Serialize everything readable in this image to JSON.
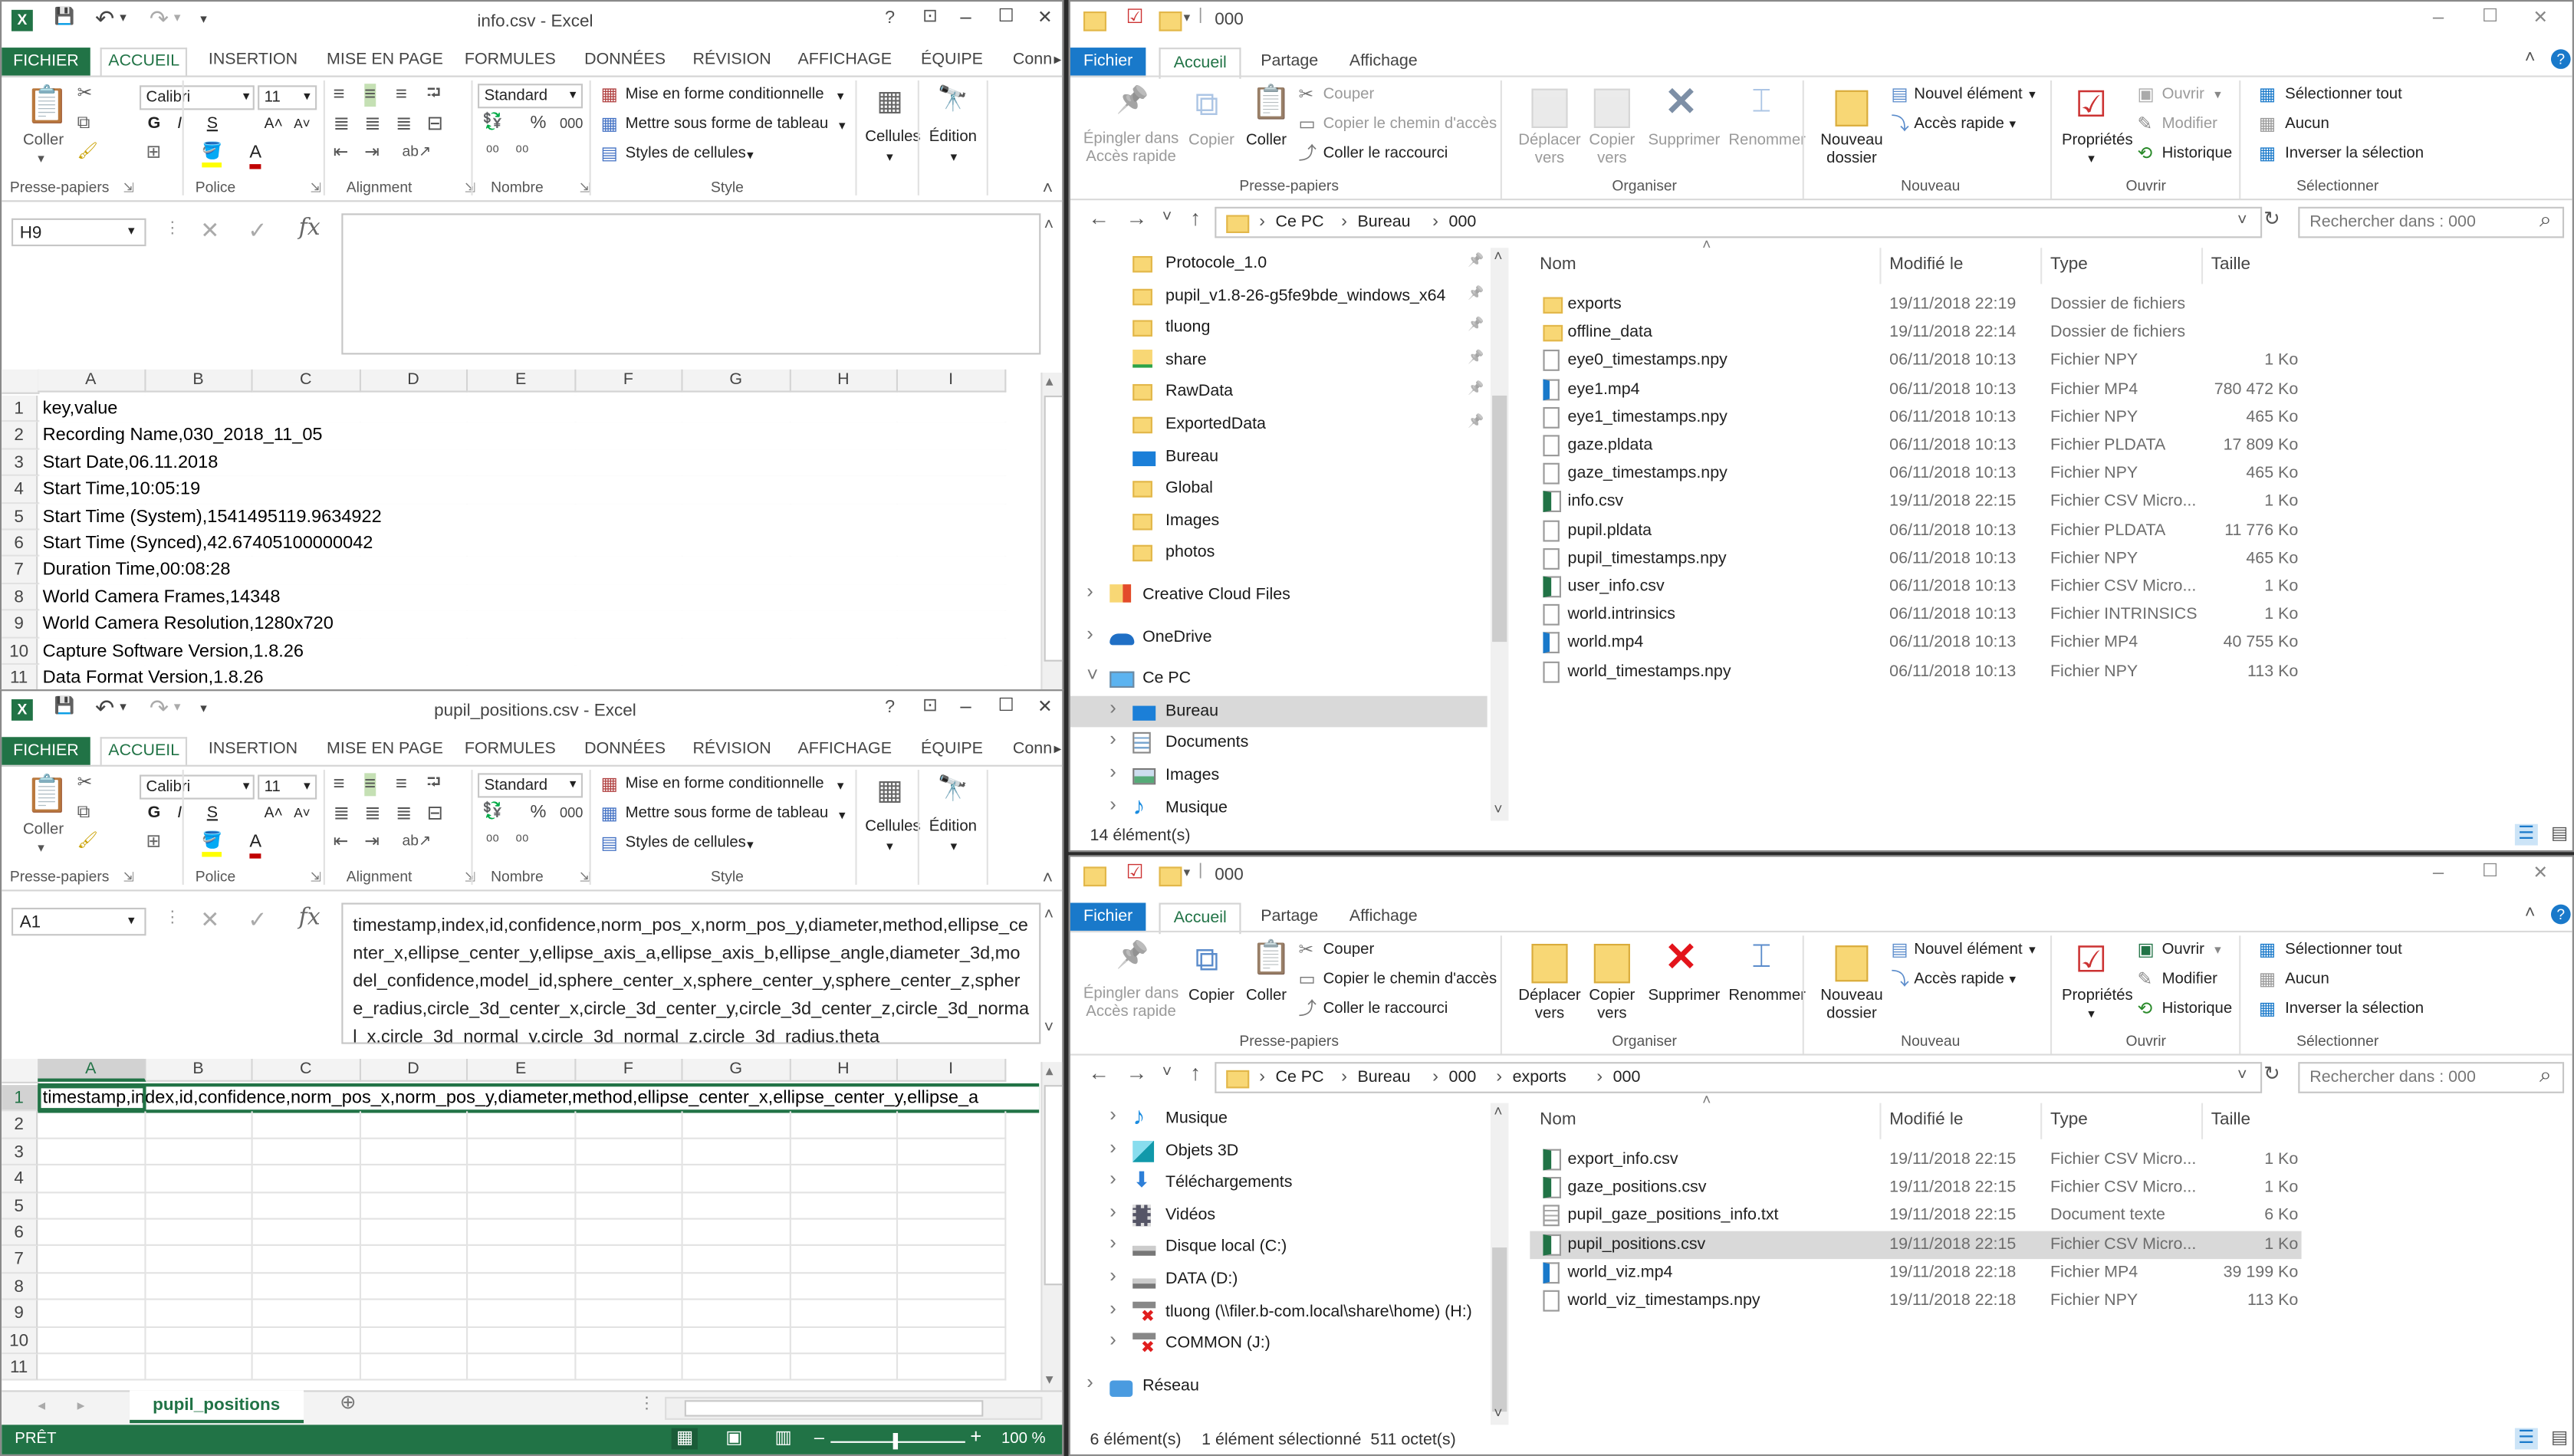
{
  "excel_ribbon": {
    "tabs": [
      "FICHIER",
      "ACCUEIL",
      "INSERTION",
      "MISE EN PAGE",
      "FORMULES",
      "DONNÉES",
      "RÉVISION",
      "AFFICHAGE",
      "ÉQUIPE",
      "Conn"
    ],
    "active_tab": "ACCUEIL",
    "paste_label": "Coller",
    "font_name": "Calibri",
    "font_size": "11",
    "bold": "G",
    "italic": "I",
    "underline": "S",
    "number_format": "Standard",
    "percent": "%",
    "thousands": "000",
    "conditional_format": "Mise en forme conditionnelle",
    "format_as_table": "Mettre sous forme de tableau",
    "cell_styles": "Styles de cellules",
    "cells": "Cellules",
    "editing": "Édition",
    "groups": [
      "Presse-papiers",
      "Police",
      "Alignment",
      "Nombre",
      "Style"
    ],
    "fx": "fx",
    "columns": [
      "A",
      "B",
      "C",
      "D",
      "E",
      "F",
      "G",
      "H",
      "I"
    ],
    "accent": "#217346"
  },
  "excel_windows": [
    {
      "title": "info.csv - Excel",
      "name_box": "H9",
      "formula": "",
      "row_numbers": [
        "1",
        "2",
        "3",
        "4",
        "5",
        "6",
        "7",
        "8",
        "9",
        "10",
        "11"
      ],
      "cells_col_a": [
        "key,value",
        "Recording Name,030_2018_11_05",
        "Start Date,06.11.2018",
        "Start Time,10:05:19",
        "Start Time (System),1541495119.9634922",
        "Start Time (Synced),42.67405100000042",
        "Duration Time,00:08:28",
        "World Camera Frames,14348",
        "World Camera Resolution,1280x720",
        "Capture Software Version,1.8.26",
        "Data Format Version,1.8.26"
      ]
    },
    {
      "title": "pupil_positions.csv - Excel",
      "name_box": "A1",
      "formula": "timestamp,index,id,confidence,norm_pos_x,norm_pos_y,diameter,method,ellipse_center_x,ellipse_center_y,ellipse_axis_a,ellipse_axis_b,ellipse_angle,diameter_3d,model_confidence,model_id,sphere_center_x,sphere_center_y,sphere_center_z,sphere_radius,circle_3d_center_x,circle_3d_center_y,circle_3d_center_z,circle_3d_normal_x,circle_3d_normal_y,circle_3d_normal_z,circle_3d_radius,theta",
      "row_numbers": [
        "1",
        "2",
        "3",
        "4",
        "5",
        "6",
        "7",
        "8",
        "9",
        "10",
        "11"
      ],
      "cells_col_a": [
        "timestamp,index,id,confidence,norm_pos_x,norm_pos_y,diameter,method,ellipse_center_x,ellipse_center_y,ellipse_a",
        "",
        "",
        "",
        "",
        "",
        "",
        "",
        "",
        "",
        ""
      ],
      "sheet_tab": "pupil_positions",
      "status": "PRÊT",
      "zoom": "100 %"
    }
  ],
  "explorer_ribbon": {
    "tabs": [
      "Fichier",
      "Accueil",
      "Partage",
      "Affichage"
    ],
    "active_tab": "Accueil",
    "pin": "Épingler dans Accès rapide",
    "copy": "Copier",
    "paste": "Coller",
    "cut": "Couper",
    "copy_path": "Copier le chemin d'accès",
    "paste_shortcut": "Coller le raccourci",
    "move_to": "Déplacer vers",
    "copy_to": "Copier vers",
    "delete": "Supprimer",
    "rename": "Renommer",
    "new_folder": "Nouveau dossier",
    "new_item": "Nouvel élément",
    "easy_access": "Accès rapide",
    "properties": "Propriétés",
    "open": "Ouvrir",
    "edit": "Modifier",
    "history": "Historique",
    "select_all": "Sélectionner tout",
    "select_none": "Aucun",
    "invert_selection": "Inverser la sélection",
    "groups": [
      "Presse-papiers",
      "Organiser",
      "Nouveau",
      "Ouvrir",
      "Sélectionner"
    ],
    "columns": [
      "Nom",
      "Modifié le",
      "Type",
      "Taille"
    ],
    "accent": "#1979ca"
  },
  "explorer_windows": [
    {
      "title": "000",
      "breadcrumb": [
        "Ce PC",
        "Bureau",
        "000"
      ],
      "search_placeholder": "Rechercher dans : 000",
      "disabled": [
        "pin",
        "copy",
        "cut",
        "copy_path",
        "move_to",
        "copy_to",
        "delete",
        "rename",
        "open",
        "edit"
      ],
      "nav": [
        {
          "label": "Protocole_1.0",
          "icon": "folder",
          "level": 2,
          "pinned": true
        },
        {
          "label": "pupil_v1.8-26-g5fe9bde_windows_x64",
          "icon": "folder",
          "level": 2,
          "pinned": true
        },
        {
          "label": "tluong",
          "icon": "folder",
          "level": 2,
          "pinned": true
        },
        {
          "label": "share",
          "icon": "network-folder",
          "level": 2,
          "pinned": true
        },
        {
          "label": "RawData",
          "icon": "folder",
          "level": 2,
          "pinned": true
        },
        {
          "label": "ExportedData",
          "icon": "folder",
          "level": 2,
          "pinned": true
        },
        {
          "label": "Bureau",
          "icon": "desktop",
          "level": 2
        },
        {
          "label": "Global",
          "icon": "folder",
          "level": 2
        },
        {
          "label": "Images",
          "icon": "folder",
          "level": 2
        },
        {
          "label": "photos",
          "icon": "folder",
          "level": 2
        },
        {
          "label": "Creative Cloud Files",
          "icon": "creative-cloud",
          "level": 1,
          "expander": ">",
          "gap": true
        },
        {
          "label": "OneDrive",
          "icon": "onedrive",
          "level": 1,
          "expander": ">",
          "gap": true
        },
        {
          "label": "Ce PC",
          "icon": "computer",
          "level": 1,
          "expander": "v",
          "gap": true
        },
        {
          "label": "Bureau",
          "icon": "desktop",
          "level": 2,
          "expander": ">",
          "selected": true
        },
        {
          "label": "Documents",
          "icon": "documents",
          "level": 2,
          "expander": ">"
        },
        {
          "label": "Images",
          "icon": "pictures",
          "level": 2,
          "expander": ">"
        },
        {
          "label": "Musique",
          "icon": "music",
          "level": 2,
          "expander": ">"
        }
      ],
      "files": [
        {
          "name": "exports",
          "modified": "19/11/2018 22:19",
          "type": "Dossier de fichiers",
          "size": "",
          "icon": "folder"
        },
        {
          "name": "offline_data",
          "modified": "19/11/2018 22:14",
          "type": "Dossier de fichiers",
          "size": "",
          "icon": "folder"
        },
        {
          "name": "eye0_timestamps.npy",
          "modified": "06/11/2018 10:13",
          "type": "Fichier NPY",
          "size": "1 Ko",
          "icon": "file"
        },
        {
          "name": "eye1.mp4",
          "modified": "06/11/2018 10:13",
          "type": "Fichier MP4",
          "size": "780 472 Ko",
          "icon": "video"
        },
        {
          "name": "eye1_timestamps.npy",
          "modified": "06/11/2018 10:13",
          "type": "Fichier NPY",
          "size": "465 Ko",
          "icon": "file"
        },
        {
          "name": "gaze.pldata",
          "modified": "06/11/2018 10:13",
          "type": "Fichier PLDATA",
          "size": "17 809 Ko",
          "icon": "file"
        },
        {
          "name": "gaze_timestamps.npy",
          "modified": "06/11/2018 10:13",
          "type": "Fichier NPY",
          "size": "465 Ko",
          "icon": "file"
        },
        {
          "name": "info.csv",
          "modified": "19/11/2018 22:15",
          "type": "Fichier CSV Micro...",
          "size": "1 Ko",
          "icon": "csv"
        },
        {
          "name": "pupil.pldata",
          "modified": "06/11/2018 10:13",
          "type": "Fichier PLDATA",
          "size": "11 776 Ko",
          "icon": "file"
        },
        {
          "name": "pupil_timestamps.npy",
          "modified": "06/11/2018 10:13",
          "type": "Fichier NPY",
          "size": "465 Ko",
          "icon": "file"
        },
        {
          "name": "user_info.csv",
          "modified": "06/11/2018 10:13",
          "type": "Fichier CSV Micro...",
          "size": "1 Ko",
          "icon": "csv"
        },
        {
          "name": "world.intrinsics",
          "modified": "06/11/2018 10:13",
          "type": "Fichier INTRINSICS",
          "size": "1 Ko",
          "icon": "file"
        },
        {
          "name": "world.mp4",
          "modified": "06/11/2018 10:13",
          "type": "Fichier MP4",
          "size": "40 755 Ko",
          "icon": "video"
        },
        {
          "name": "world_timestamps.npy",
          "modified": "06/11/2018 10:13",
          "type": "Fichier NPY",
          "size": "113 Ko",
          "icon": "file"
        }
      ],
      "status": "14 élément(s)",
      "selection_status": ""
    },
    {
      "title": "000",
      "breadcrumb": [
        "Ce PC",
        "Bureau",
        "000",
        "exports",
        "000"
      ],
      "search_placeholder": "Rechercher dans : 000",
      "disabled": [
        "pin"
      ],
      "nav": [
        {
          "label": "Musique",
          "icon": "music",
          "level": 2,
          "expander": ">"
        },
        {
          "label": "Objets 3D",
          "icon": "objects-3d",
          "level": 2,
          "expander": ">"
        },
        {
          "label": "Téléchargements",
          "icon": "downloads",
          "level": 2,
          "expander": ">"
        },
        {
          "label": "Vidéos",
          "icon": "videos",
          "level": 2,
          "expander": ">"
        },
        {
          "label": "Disque local (C:)",
          "icon": "drive",
          "level": 2,
          "expander": ">"
        },
        {
          "label": "DATA (D:)",
          "icon": "drive",
          "level": 2,
          "expander": ">"
        },
        {
          "label": "tluong (\\\\filer.b-com.local\\share\\home) (H:)",
          "icon": "network-drive-disconnected",
          "level": 2,
          "expander": ">"
        },
        {
          "label": "COMMON (J:)",
          "icon": "network-drive-disconnected",
          "level": 2,
          "expander": ">"
        },
        {
          "label": "Réseau",
          "icon": "network",
          "level": 1,
          "expander": ">",
          "gap": true
        }
      ],
      "files": [
        {
          "name": "export_info.csv",
          "modified": "19/11/2018 22:15",
          "type": "Fichier CSV Micro...",
          "size": "1 Ko",
          "icon": "csv"
        },
        {
          "name": "gaze_positions.csv",
          "modified": "19/11/2018 22:15",
          "type": "Fichier CSV Micro...",
          "size": "1 Ko",
          "icon": "csv"
        },
        {
          "name": "pupil_gaze_positions_info.txt",
          "modified": "19/11/2018 22:15",
          "type": "Document texte",
          "size": "6 Ko",
          "icon": "text"
        },
        {
          "name": "pupil_positions.csv",
          "modified": "19/11/2018 22:15",
          "type": "Fichier CSV Micro...",
          "size": "1 Ko",
          "icon": "csv",
          "selected": true
        },
        {
          "name": "world_viz.mp4",
          "modified": "19/11/2018 22:18",
          "type": "Fichier MP4",
          "size": "39 199 Ko",
          "icon": "video"
        },
        {
          "name": "world_viz_timestamps.npy",
          "modified": "19/11/2018 22:18",
          "type": "Fichier NPY",
          "size": "113 Ko",
          "icon": "file"
        }
      ],
      "status": "6 élément(s)",
      "selection_status": "1 élément sélectionné  511 octet(s)"
    }
  ]
}
